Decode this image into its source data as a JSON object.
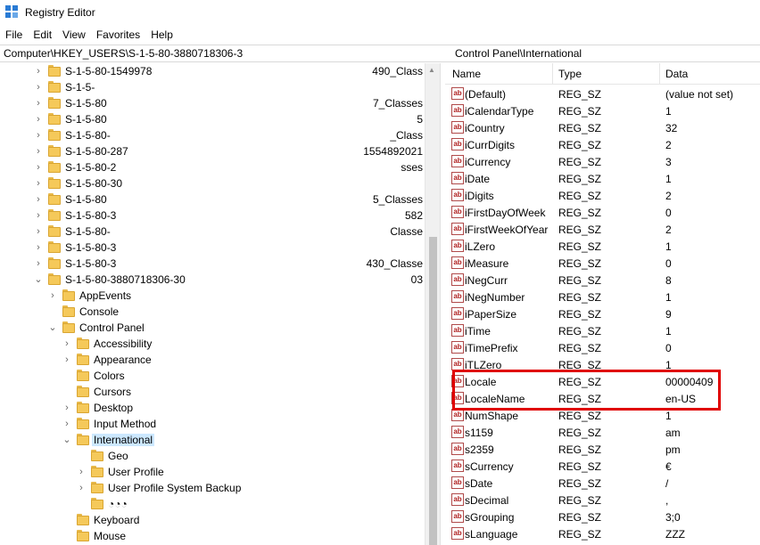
{
  "window": {
    "title": "Registry Editor",
    "icon": "registry-editor-icon"
  },
  "menu": [
    "File",
    "Edit",
    "View",
    "Favorites",
    "Help"
  ],
  "address": {
    "prefix": "Computer\\HKEY_USERS\\S-1-5-80-3880718306-3",
    "suffix": "Control Panel\\International"
  },
  "tree": {
    "rows": [
      {
        "label": "S-1-5-80-1549978",
        "suffix": "490_Class",
        "level": 0,
        "expander": "right",
        "selected": false
      },
      {
        "label": "S-1-5-",
        "suffix": "",
        "level": 0,
        "expander": "right",
        "selected": false
      },
      {
        "label": "S-1-5-80",
        "suffix": "7_Classes",
        "level": 0,
        "expander": "right",
        "selected": false
      },
      {
        "label": "S-1-5-80",
        "suffix": "5",
        "level": 0,
        "expander": "right",
        "selected": false
      },
      {
        "label": "S-1-5-80-",
        "suffix": "_Class",
        "level": 0,
        "expander": "right",
        "selected": false
      },
      {
        "label": "S-1-5-80-287",
        "suffix": "1554892021",
        "level": 0,
        "expander": "right",
        "selected": false
      },
      {
        "label": "S-1-5-80-2",
        "suffix": "sses",
        "level": 0,
        "expander": "right",
        "selected": false
      },
      {
        "label": "S-1-5-80-30",
        "suffix": "",
        "level": 0,
        "expander": "right",
        "selected": false
      },
      {
        "label": "S-1-5-80",
        "suffix": "5_Classes",
        "level": 0,
        "expander": "right",
        "selected": false
      },
      {
        "label": "S-1-5-80-3",
        "suffix": "582",
        "level": 0,
        "expander": "right",
        "selected": false
      },
      {
        "label": "S-1-5-80-",
        "suffix": "Classe",
        "level": 0,
        "expander": "right",
        "selected": false
      },
      {
        "label": "S-1-5-80-3",
        "suffix": "",
        "level": 0,
        "expander": "right",
        "selected": false
      },
      {
        "label": "S-1-5-80-3",
        "suffix": "430_Classe",
        "level": 0,
        "expander": "right",
        "selected": false
      },
      {
        "label": "S-1-5-80-3880718306-30",
        "suffix": "03",
        "level": 0,
        "expander": "down",
        "selected": false
      },
      {
        "label": "AppEvents",
        "suffix": "",
        "level": 1,
        "expander": "right",
        "selected": false
      },
      {
        "label": "Console",
        "suffix": "",
        "level": 1,
        "expander": "none",
        "selected": false
      },
      {
        "label": "Control Panel",
        "suffix": "",
        "level": 1,
        "expander": "down",
        "selected": false
      },
      {
        "label": "Accessibility",
        "suffix": "",
        "level": 2,
        "expander": "right",
        "selected": false
      },
      {
        "label": "Appearance",
        "suffix": "",
        "level": 2,
        "expander": "right",
        "selected": false
      },
      {
        "label": "Colors",
        "suffix": "",
        "level": 2,
        "expander": "none",
        "selected": false
      },
      {
        "label": "Cursors",
        "suffix": "",
        "level": 2,
        "expander": "none",
        "selected": false
      },
      {
        "label": "Desktop",
        "suffix": "",
        "level": 2,
        "expander": "right",
        "selected": false
      },
      {
        "label": "Input Method",
        "suffix": "",
        "level": 2,
        "expander": "right",
        "selected": false
      },
      {
        "label": "International",
        "suffix": "",
        "level": 2,
        "expander": "down",
        "selected": true
      },
      {
        "label": "Geo",
        "suffix": "",
        "level": 3,
        "expander": "none",
        "selected": false
      },
      {
        "label": "User Profile",
        "suffix": "",
        "level": 3,
        "expander": "right",
        "selected": false
      },
      {
        "label": "User Profile System Backup",
        "suffix": "",
        "level": 3,
        "expander": "right",
        "selected": false
      },
      {
        "label": "◔◔◔",
        "suffix": "",
        "level": 3,
        "expander": "none",
        "selected": false
      },
      {
        "label": "Keyboard",
        "suffix": "",
        "level": 2,
        "expander": "none",
        "selected": false
      },
      {
        "label": "Mouse",
        "suffix": "",
        "level": 2,
        "expander": "none",
        "selected": false
      }
    ]
  },
  "list": {
    "columns": [
      "Name",
      "Type",
      "Data"
    ],
    "rows": [
      {
        "name": "(Default)",
        "type": "REG_SZ",
        "data": "(value not set)"
      },
      {
        "name": "iCalendarType",
        "type": "REG_SZ",
        "data": "1"
      },
      {
        "name": "iCountry",
        "type": "REG_SZ",
        "data": "32"
      },
      {
        "name": "iCurrDigits",
        "type": "REG_SZ",
        "data": "2"
      },
      {
        "name": "iCurrency",
        "type": "REG_SZ",
        "data": "3"
      },
      {
        "name": "iDate",
        "type": "REG_SZ",
        "data": "1"
      },
      {
        "name": "iDigits",
        "type": "REG_SZ",
        "data": "2"
      },
      {
        "name": "iFirstDayOfWeek",
        "type": "REG_SZ",
        "data": "0"
      },
      {
        "name": "iFirstWeekOfYear",
        "type": "REG_SZ",
        "data": "2"
      },
      {
        "name": "iLZero",
        "type": "REG_SZ",
        "data": "1"
      },
      {
        "name": "iMeasure",
        "type": "REG_SZ",
        "data": "0"
      },
      {
        "name": "iNegCurr",
        "type": "REG_SZ",
        "data": "8"
      },
      {
        "name": "iNegNumber",
        "type": "REG_SZ",
        "data": "1"
      },
      {
        "name": "iPaperSize",
        "type": "REG_SZ",
        "data": "9"
      },
      {
        "name": "iTime",
        "type": "REG_SZ",
        "data": "1"
      },
      {
        "name": "iTimePrefix",
        "type": "REG_SZ",
        "data": "0"
      },
      {
        "name": "iTLZero",
        "type": "REG_SZ",
        "data": "1"
      },
      {
        "name": "Locale",
        "type": "REG_SZ",
        "data": "00000409"
      },
      {
        "name": "LocaleName",
        "type": "REG_SZ",
        "data": "en-US"
      },
      {
        "name": "NumShape",
        "type": "REG_SZ",
        "data": "1"
      },
      {
        "name": "s1159",
        "type": "REG_SZ",
        "data": "am"
      },
      {
        "name": "s2359",
        "type": "REG_SZ",
        "data": "pm"
      },
      {
        "name": "sCurrency",
        "type": "REG_SZ",
        "data": "€"
      },
      {
        "name": "sDate",
        "type": "REG_SZ",
        "data": "/"
      },
      {
        "name": "sDecimal",
        "type": "REG_SZ",
        "data": ","
      },
      {
        "name": "sGrouping",
        "type": "REG_SZ",
        "data": "3;0"
      },
      {
        "name": "sLanguage",
        "type": "REG_SZ",
        "data": "ZZZ"
      }
    ],
    "value_icon": "string-value-icon",
    "value_icon_text": "ab"
  },
  "colors": {
    "highlight": "#e00000",
    "selection": "#cce8ff",
    "folder": "#f5c95a"
  }
}
